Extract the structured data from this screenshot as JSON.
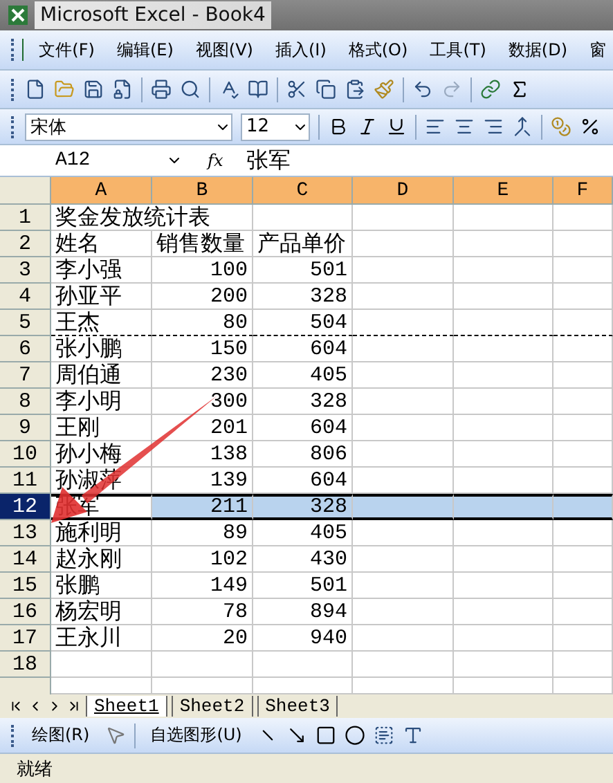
{
  "window": {
    "title": "Microsoft Excel - Book4"
  },
  "menu": [
    "文件(F)",
    "编辑(E)",
    "视图(V)",
    "插入(I)",
    "格式(O)",
    "工具(T)",
    "数据(D)",
    "窗"
  ],
  "format_toolbar": {
    "font": "宋体",
    "size": "12"
  },
  "formula_bar": {
    "name_box": "A12",
    "fx": "fx",
    "value": "张军"
  },
  "columns": [
    {
      "label": "A",
      "selected": true
    },
    {
      "label": "B",
      "selected": true
    },
    {
      "label": "C",
      "selected": true
    },
    {
      "label": "D",
      "selected": true
    },
    {
      "label": "E",
      "selected": true
    },
    {
      "label": "F",
      "selected": true
    }
  ],
  "rows": [
    {
      "number": "1",
      "cells": [
        "奖金发放统计表",
        "",
        ""
      ],
      "selected": false,
      "page_break": false
    },
    {
      "number": "2",
      "cells": [
        "姓名",
        "销售数量",
        "产品单价"
      ],
      "selected": false,
      "page_break": false
    },
    {
      "number": "3",
      "cells": [
        "李小强",
        "100",
        "501"
      ],
      "selected": false,
      "page_break": false
    },
    {
      "number": "4",
      "cells": [
        "孙亚平",
        "200",
        "328"
      ],
      "selected": false,
      "page_break": false
    },
    {
      "number": "5",
      "cells": [
        "王杰",
        "80",
        "504"
      ],
      "selected": false,
      "page_break": true
    },
    {
      "number": "6",
      "cells": [
        "张小鹏",
        "150",
        "604"
      ],
      "selected": false,
      "page_break": false
    },
    {
      "number": "7",
      "cells": [
        "周伯通",
        "230",
        "405"
      ],
      "selected": false,
      "page_break": false
    },
    {
      "number": "8",
      "cells": [
        "李小明",
        "300",
        "328"
      ],
      "selected": false,
      "page_break": false
    },
    {
      "number": "9",
      "cells": [
        "王刚",
        "201",
        "604"
      ],
      "selected": false,
      "page_break": false
    },
    {
      "number": "10",
      "cells": [
        "孙小梅",
        "138",
        "806"
      ],
      "selected": false,
      "page_break": false
    },
    {
      "number": "11",
      "cells": [
        "孙淑萍",
        "139",
        "604"
      ],
      "selected": false,
      "page_break": false
    },
    {
      "number": "12",
      "cells": [
        "张军",
        "211",
        "328"
      ],
      "selected": true,
      "page_break": false
    },
    {
      "number": "13",
      "cells": [
        "施利明",
        "89",
        "405"
      ],
      "selected": false,
      "page_break": false
    },
    {
      "number": "14",
      "cells": [
        "赵永刚",
        "102",
        "430"
      ],
      "selected": false,
      "page_break": false
    },
    {
      "number": "15",
      "cells": [
        "张鹏",
        "149",
        "501"
      ],
      "selected": false,
      "page_break": false
    },
    {
      "number": "16",
      "cells": [
        "杨宏明",
        "78",
        "894"
      ],
      "selected": false,
      "page_break": false
    },
    {
      "number": "17",
      "cells": [
        "王永川",
        "20",
        "940"
      ],
      "selected": false,
      "page_break": false
    },
    {
      "number": "18",
      "cells": [
        "",
        "",
        ""
      ],
      "selected": false,
      "page_break": false
    }
  ],
  "sheet_tabs": [
    {
      "label": "Sheet1",
      "selected": true
    },
    {
      "label": "Sheet2",
      "selected": false
    },
    {
      "label": "Sheet3",
      "selected": false
    }
  ],
  "drawing_toolbar": {
    "draw_menu": "绘图(R)",
    "autoshapes_menu": "自选图形(U)"
  },
  "status_bar": {
    "text": "就绪"
  }
}
